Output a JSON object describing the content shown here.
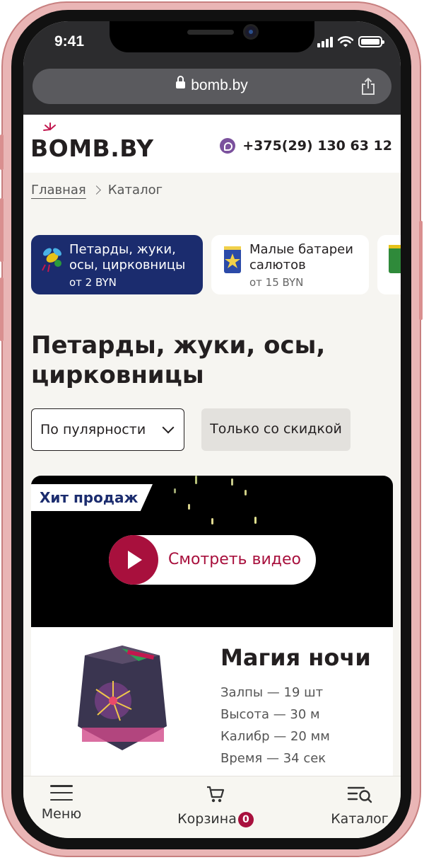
{
  "status_bar": {
    "time": "9:41"
  },
  "browser": {
    "url": "bomb.by"
  },
  "header": {
    "logo": "BOMB.BY",
    "phone": "+375(29) 130 63 12"
  },
  "breadcrumb": {
    "home": "Главная",
    "current": "Каталог"
  },
  "categories": [
    {
      "title_line1": "Петарды, жуки,",
      "title_line2": "осы, цирковницы",
      "price": "от 2 BYN",
      "active": true
    },
    {
      "title_line1": "Малые батареи",
      "title_line2": "салютов",
      "price": "от 15 BYN",
      "active": false
    }
  ],
  "page_title": {
    "line1": "Петарды, жуки, осы,",
    "line2": "цирковницы"
  },
  "filters": {
    "sort_value": "По пулярности",
    "discount_label": "Только со скидкой"
  },
  "product": {
    "badge": "Хит продаж",
    "video_label": "Смотреть видео",
    "name": "Магия ночи",
    "specs": [
      "Залпы — 19 шт",
      "Высота — 30 м",
      "Калибр — 20 мм",
      "Время — 34 сек"
    ]
  },
  "bottom_nav": {
    "menu": "Меню",
    "cart": "Корзина",
    "cart_count": "0",
    "catalog": "Каталог"
  },
  "colors": {
    "accent": "#a8103d",
    "navy": "#1b2c6e",
    "background": "#f6f5f1"
  }
}
